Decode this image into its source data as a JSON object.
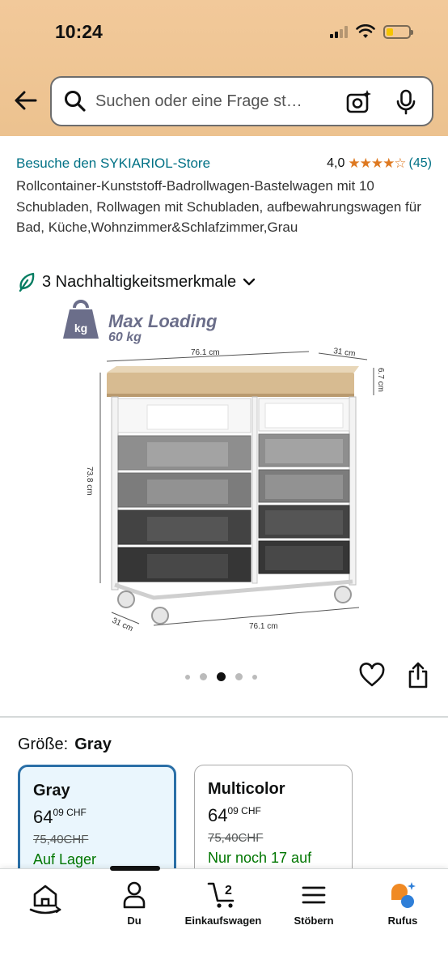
{
  "status": {
    "time": "10:24"
  },
  "search": {
    "placeholder": "Suchen oder eine Frage st…"
  },
  "product": {
    "store_link": "Besuche den SYKIARIOL-Store",
    "rating_value": "4,0",
    "rating_stars": "★★★★☆",
    "rating_count": "(45)",
    "title": "Rollcontainer-Kunststoff-Badrollwagen-Bastelwagen mit 10 Schubladen, Rollwagen mit Schubladen, aufbewahrungswagen für Bad, Küche,Wohnzimmer&Schlafzimmer,Grau",
    "sustainability": "3 Nachhaltigkeitsmerkmale"
  },
  "image": {
    "max_loading": "Max Loading",
    "weight": "60 kg",
    "kg_badge": "kg",
    "dim_width_top": "76.1 cm",
    "dim_depth_top": "31 cm",
    "dim_top_height": "6.7 cm",
    "dim_height": "73.8 cm",
    "dim_depth_bottom": "31 cm",
    "dim_width_bottom": "76.1 cm"
  },
  "carousel": {
    "total": 5,
    "active_index": 2
  },
  "size": {
    "label": "Größe:",
    "selected": "Gray"
  },
  "variants": [
    {
      "name": "Gray",
      "price_main": "64",
      "price_cents": "09 CHF",
      "old_price": "75,40CHF",
      "stock": "Auf Lager"
    },
    {
      "name": "Multicolor",
      "price_main": "64",
      "price_cents": "09 CHF",
      "old_price": "75,40CHF",
      "stock": "Nur noch 17 auf"
    }
  ],
  "nav": {
    "home": "",
    "you": "Du",
    "cart": "Einkaufswagen",
    "cart_count": "2",
    "browse": "Stöbern",
    "rufus": "Rufus"
  },
  "colors": {
    "header": "#ecc28f",
    "link": "#007185",
    "star": "#de7921",
    "stock": "#007600",
    "selected_border": "#2a6fa7"
  }
}
